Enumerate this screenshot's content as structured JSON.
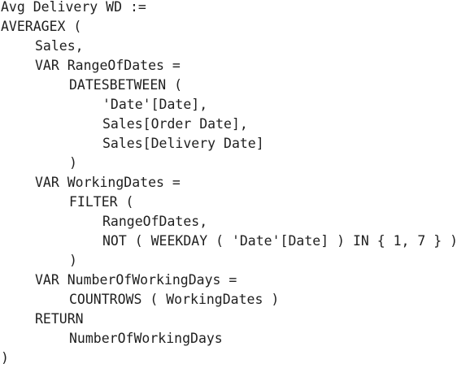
{
  "code": {
    "lines": [
      "Avg Delivery WD :=",
      "AVERAGEX (",
      "Sales,",
      "VAR RangeOfDates =",
      "DATESBETWEEN (",
      "'Date'[Date],",
      "Sales[Order Date],",
      "Sales[Delivery Date]",
      ")",
      "VAR WorkingDates =",
      "FILTER (",
      "RangeOfDates,",
      "NOT ( WEEKDAY ( 'Date'[Date] ) IN { 1, 7 } )",
      ")",
      "VAR NumberOfWorkingDays =",
      "COUNTROWS ( WorkingDates )",
      "RETURN",
      "NumberOfWorkingDays",
      ")"
    ]
  }
}
